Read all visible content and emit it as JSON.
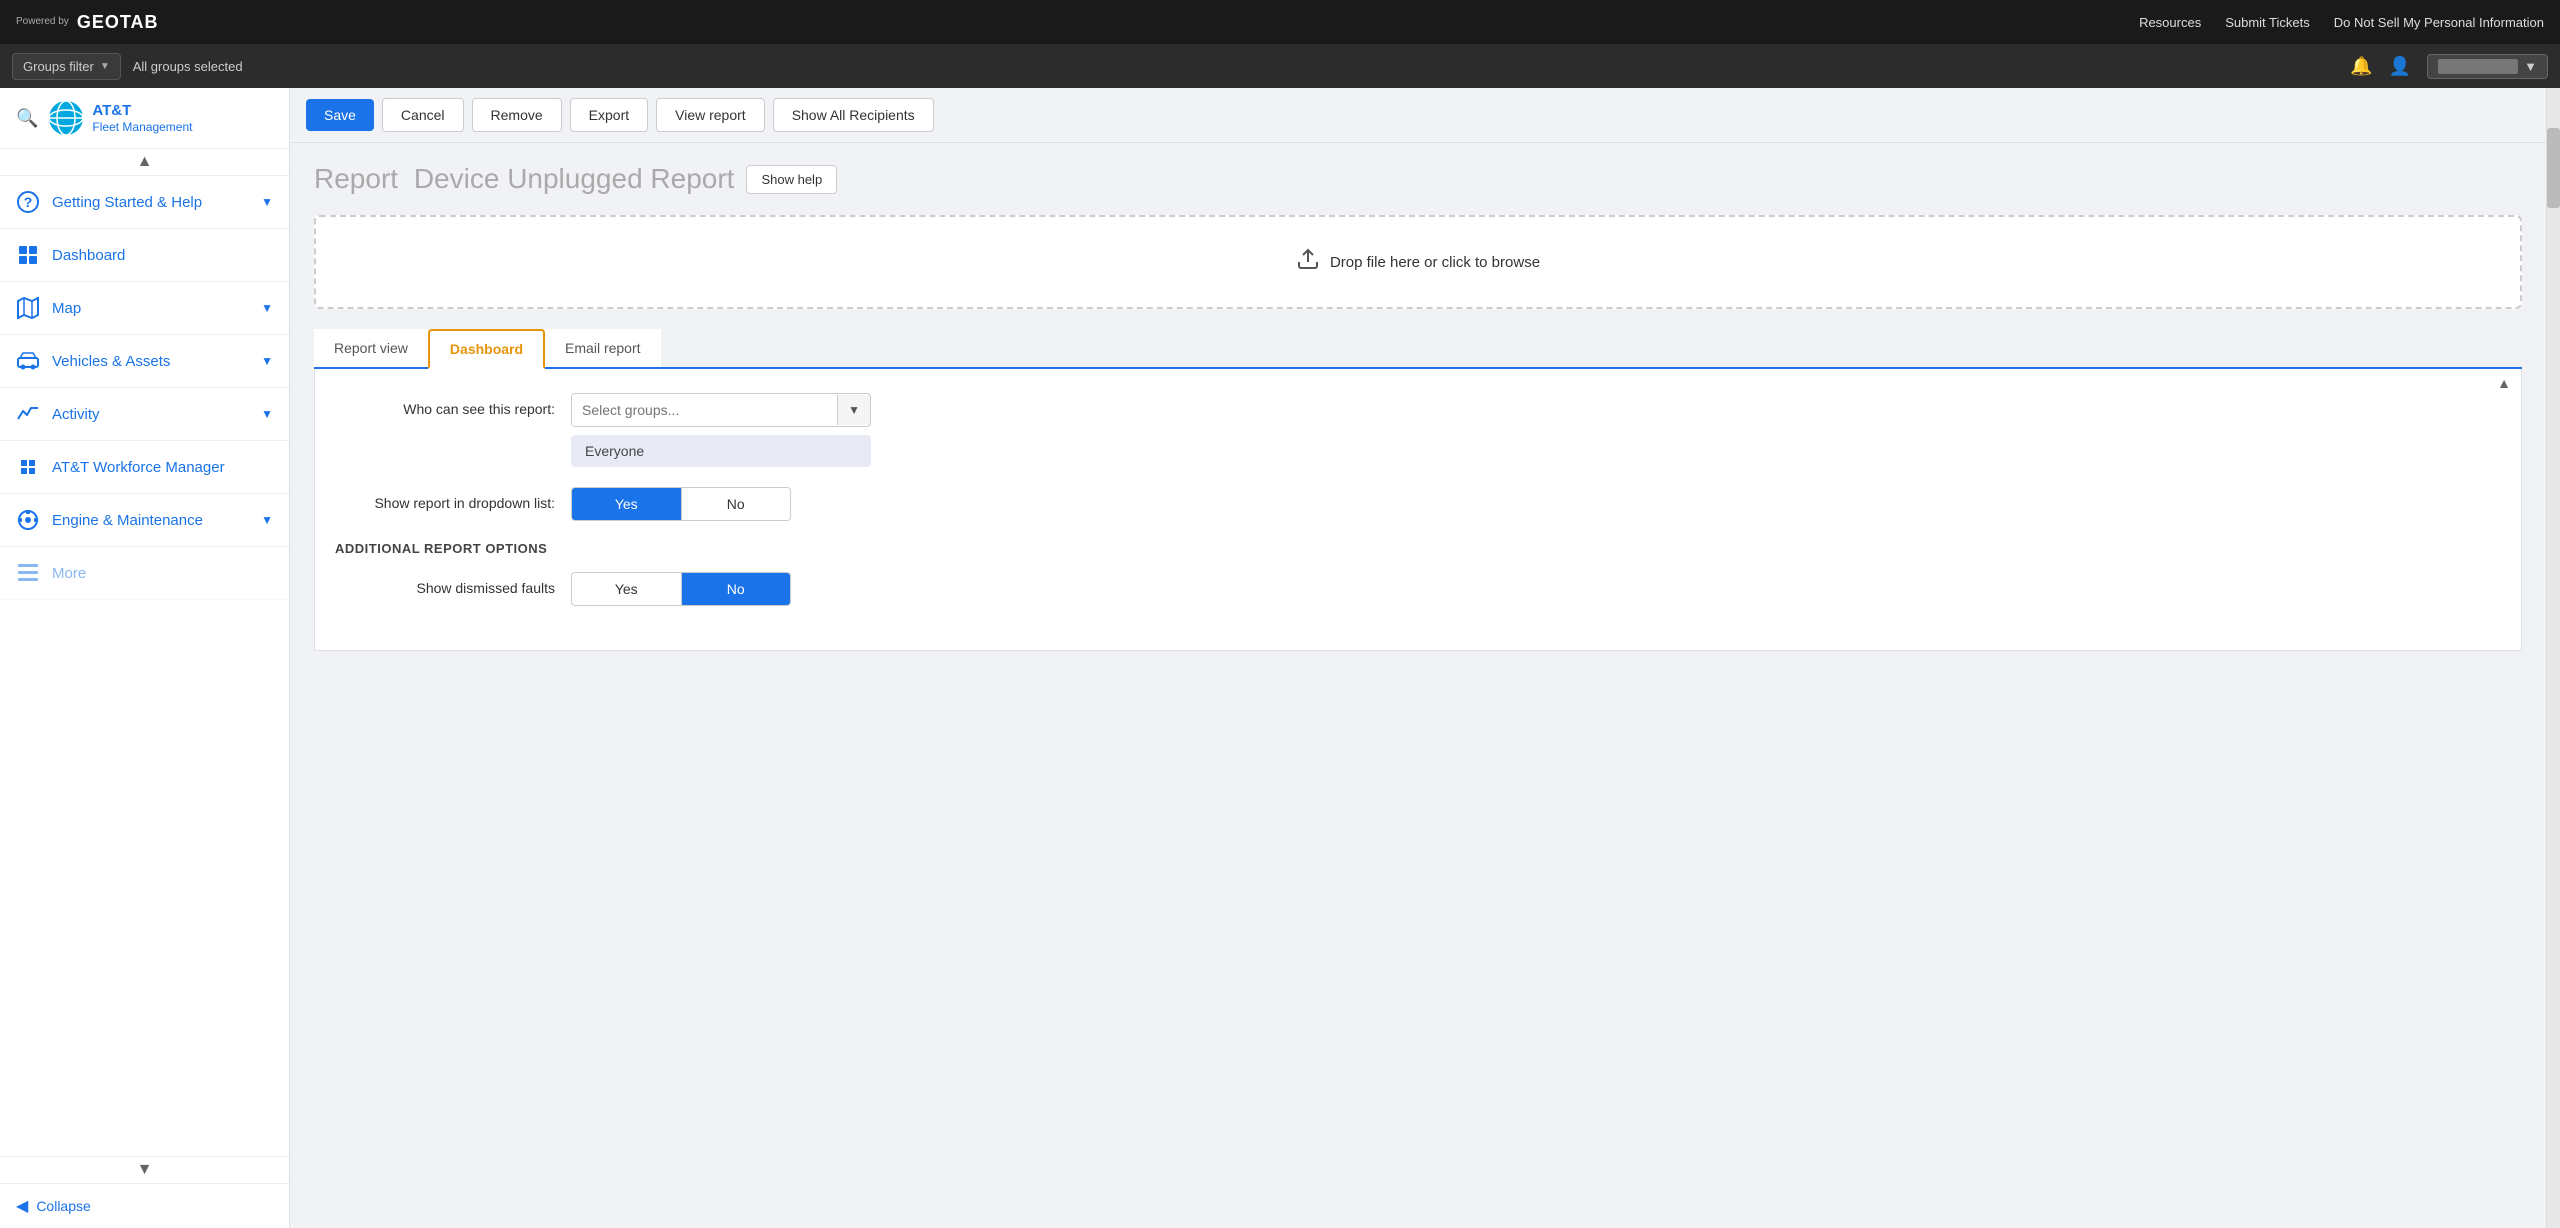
{
  "topNav": {
    "poweredBy": "Powered by",
    "logoText": "GEOTAB",
    "links": [
      "Resources",
      "Submit Tickets",
      "Do Not Sell My Personal Information"
    ]
  },
  "groupsBar": {
    "filterLabel": "Groups filter",
    "selectedText": "All groups selected"
  },
  "sidebar": {
    "brand": {
      "name": "AT&T",
      "sub": "Fleet Management"
    },
    "items": [
      {
        "label": "Getting Started & Help",
        "icon": "❓",
        "hasArrow": true
      },
      {
        "label": "Dashboard",
        "icon": "📊",
        "hasArrow": false
      },
      {
        "label": "Map",
        "icon": "🗺",
        "hasArrow": true
      },
      {
        "label": "Vehicles & Assets",
        "icon": "🚗",
        "hasArrow": true
      },
      {
        "label": "Activity",
        "icon": "📈",
        "hasArrow": true
      },
      {
        "label": "AT&T Workforce Manager",
        "icon": "🧩",
        "hasArrow": false
      },
      {
        "label": "Engine & Maintenance",
        "icon": "🎬",
        "hasArrow": true
      },
      {
        "label": "More",
        "icon": "✉",
        "hasArrow": false
      }
    ],
    "collapseLabel": "Collapse"
  },
  "toolbar": {
    "saveLabel": "Save",
    "cancelLabel": "Cancel",
    "removeLabel": "Remove",
    "exportLabel": "Export",
    "viewReportLabel": "View report",
    "showAllRecipientsLabel": "Show All Recipients"
  },
  "report": {
    "titleLabel": "Report",
    "titleName": "Device Unplugged Report",
    "showHelpLabel": "Show help"
  },
  "dropzone": {
    "text": "Drop file here or click to browse"
  },
  "tabs": [
    {
      "label": "Report view",
      "active": false
    },
    {
      "label": "Dashboard",
      "active": true
    },
    {
      "label": "Email report",
      "active": false
    }
  ],
  "dashboardPanel": {
    "whoCanSeeLabel": "Who can see this report:",
    "selectGroupsPlaceholder": "Select groups...",
    "everyoneTag": "Everyone",
    "showDropdownLabel": "Show report in dropdown list:",
    "yesLabel": "Yes",
    "noLabel": "No",
    "additionalOptionsHeader": "ADDITIONAL REPORT OPTIONS",
    "showDismissedLabel": "Show dismissed faults",
    "showDismissedYes": "Yes",
    "showDismissedNo": "No"
  }
}
